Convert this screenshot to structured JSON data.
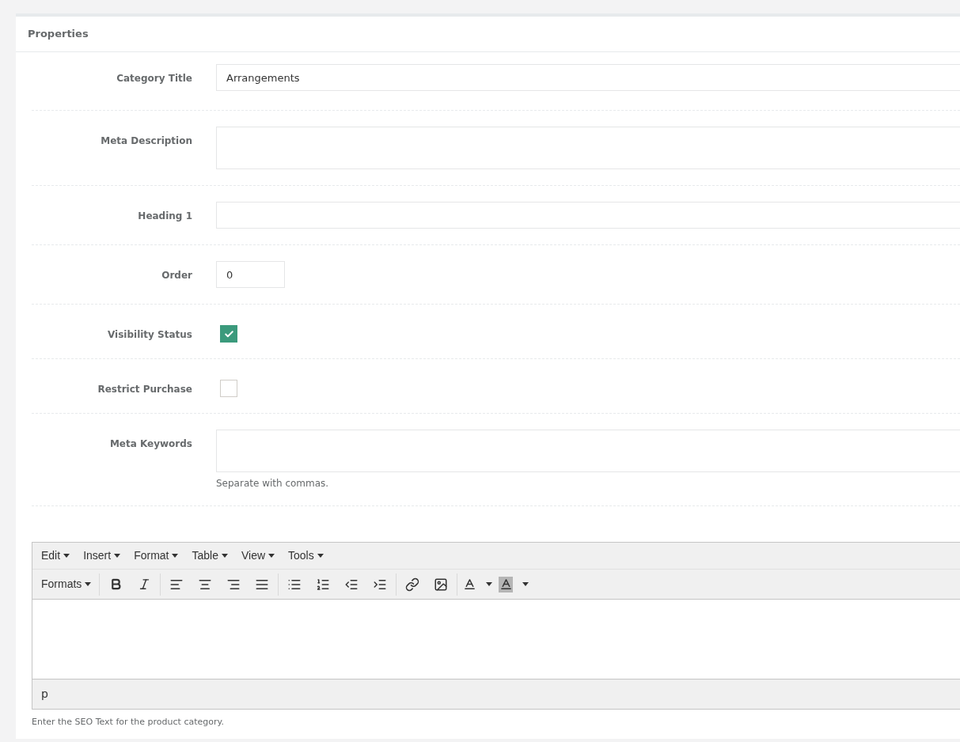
{
  "panel": {
    "title": "Properties"
  },
  "fields": [
    {
      "kind": "text",
      "label": "Category Title",
      "value": "Arrangements"
    },
    {
      "kind": "textarea",
      "label": "Meta Description"
    },
    {
      "kind": "text",
      "label": "Heading 1"
    },
    {
      "kind": "number",
      "label": "Order",
      "value": "0"
    },
    {
      "kind": "checkbox",
      "label": "Visibility Status",
      "checked": true
    },
    {
      "kind": "checkbox",
      "label": "Restrict Purchase",
      "checked": false
    },
    {
      "kind": "textarea",
      "label": "Meta Keywords",
      "help": "Separate with commas."
    }
  ],
  "editor": {
    "menus": [
      "Edit",
      "Insert",
      "Format",
      "Table",
      "View",
      "Tools"
    ],
    "formats_label": "Formats",
    "status_path": "p",
    "help": "Enter the SEO Text for the product category."
  }
}
